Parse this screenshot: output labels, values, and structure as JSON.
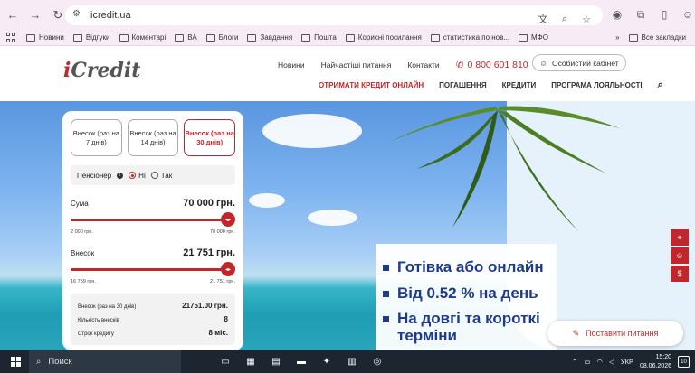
{
  "browser": {
    "url": "icredit.ua",
    "bookmarks": [
      "Новини",
      "Відгуки",
      "Коментарі",
      "ВА",
      "Блоги",
      "Завдання",
      "Пошта",
      "Корисні посилання",
      "статистика по нов...",
      "МФО"
    ],
    "all_bookmarks": "Все закладки",
    "overflow": "»"
  },
  "site": {
    "logo_i": "i",
    "logo_rest": "Credit",
    "top_nav": [
      "Новини",
      "Найчастіші питання",
      "Контакти"
    ],
    "phone": "0 800 601 810",
    "cabinet": "Особистий кабінет",
    "main_nav": [
      "ОТРИМАТИ КРЕДИТ ОНЛАЙН",
      "ПОГАШЕННЯ",
      "КРЕДИТИ",
      "ПРОГРАМА ЛОЯЛЬНОСТІ"
    ]
  },
  "calculator": {
    "tabs": [
      {
        "label": "Внесок (раз на 7 днів)",
        "active": false
      },
      {
        "label": "Внесок (раз на 14 днів)",
        "active": false
      },
      {
        "label": "Внесок (раз на 30 днів)",
        "active": true
      }
    ],
    "pensioner_label": "Пенсіонер",
    "pensioner_no": "Ні",
    "pensioner_yes": "Так",
    "amount_label": "Сума",
    "amount_value": "70 000 грн.",
    "amount_min": "2 000 грн.",
    "amount_max": "70 000 грн.",
    "amount_level": 1.0,
    "payment_label": "Внесок",
    "payment_value": "21 751 грн.",
    "payment_min": "16 759 грн.",
    "payment_max": "21 751 грн.",
    "payment_level": 1.0,
    "summary": [
      {
        "label": "Внесок (раз на 30 днів)",
        "value": "21751.00 грн."
      },
      {
        "label": "Кількість внесків",
        "value": "8"
      },
      {
        "label": "Строк кредиту",
        "value": "8 міс."
      }
    ]
  },
  "hero": {
    "benefits": [
      "Готівка або онлайн",
      "Від 0.52 % на день",
      "На довгі та короткі терміни"
    ],
    "ask_button": "Поставити питання"
  },
  "taskbar": {
    "search": "Поиск",
    "lang": "УКР",
    "time": "15:20",
    "date": "08.06.2026",
    "notifications": "10"
  }
}
